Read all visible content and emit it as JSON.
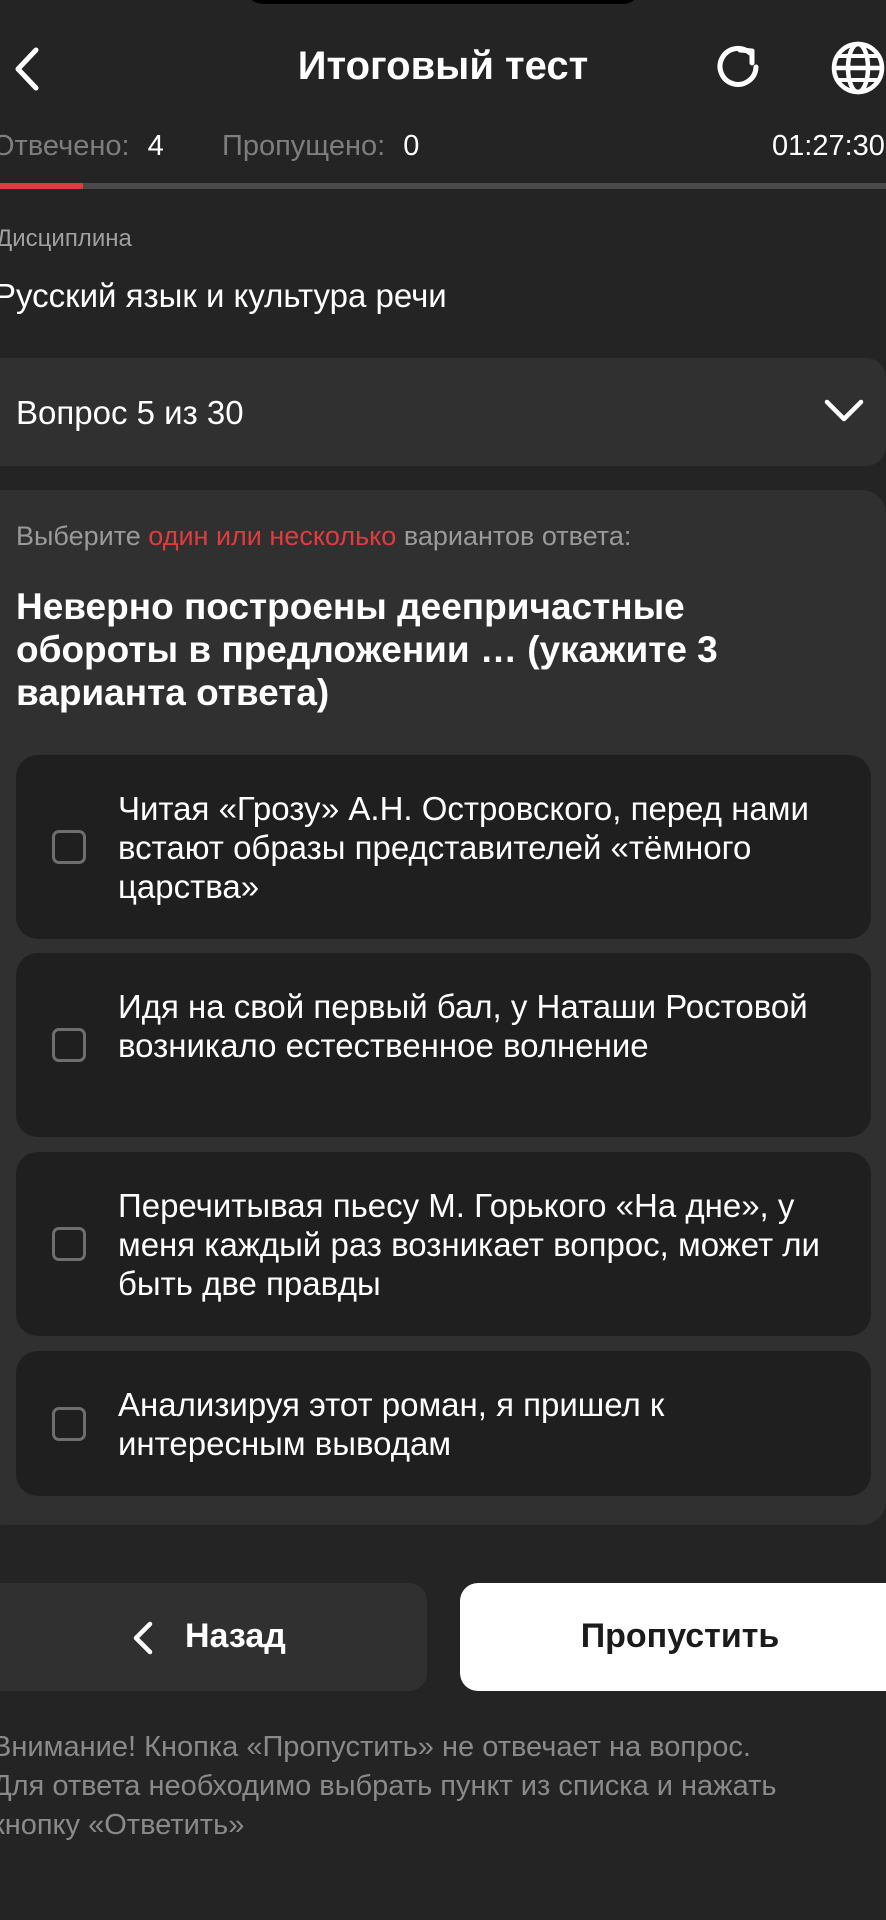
{
  "header": {
    "title": "Итоговый тест",
    "back_icon": "chevron-left-icon",
    "refresh_icon": "refresh-icon",
    "language_icon": "globe-icon"
  },
  "status": {
    "answered_label": "Отвечено:",
    "answered_count": "4",
    "skipped_label": "Пропущено:",
    "skipped_count": "0",
    "timer": "01:27:30",
    "progress_fraction": 0.0933
  },
  "discipline": {
    "label": "Дисциплина",
    "value": "Русский язык и культура речи"
  },
  "question_selector": {
    "label": "Вопрос 5 из 30"
  },
  "question": {
    "instruction_prefix": "Выберите",
    "instruction_highlight": "один или несколько",
    "instruction_suffix": "вариантов ответа:",
    "text": "Неверно построены деепричастные обороты в предложении … (укажите 3 варианта ответа)",
    "options": [
      {
        "label": "Читая «Грозу» А.Н. Островского, перед нами встают образы представителей «тёмного царства»",
        "checked": false
      },
      {
        "label": "Идя на свой первый бал, у Наташи Ростовой возникало естественное волнение",
        "checked": false
      },
      {
        "label": "Перечитывая пьесу М. Горького «На дне», у меня каждый раз возникает вопрос, может ли быть две правды",
        "checked": false
      },
      {
        "label": "Анализируя этот роман, я пришел к интересным выводам",
        "checked": false
      }
    ]
  },
  "buttons": {
    "back_label": "Назад",
    "skip_label": "Пропустить"
  },
  "notice": {
    "line1": "Внимание! Кнопка «Пропустить» не отвечает на вопрос.",
    "line2": "Для ответа необходимо выбрать пункт из списка и нажать",
    "line3": "кнопку «Ответить»"
  },
  "colors": {
    "background": "#242424",
    "surface": "#303030",
    "option_surface": "#1f1f1f",
    "accent_red": "#e03b3e"
  }
}
